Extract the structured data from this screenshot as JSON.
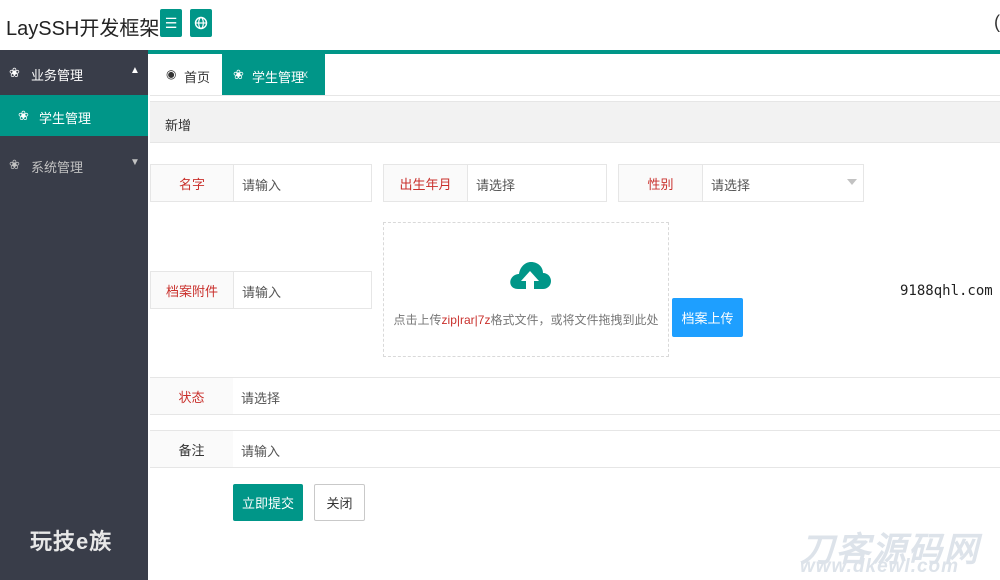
{
  "header": {
    "brand": "LaySSH开发框架",
    "menu_icon": "menu-icon",
    "globe_icon": "globe-icon",
    "right_text": "("
  },
  "sidebar": {
    "groups": [
      {
        "label": "业务管理",
        "icon": "cluster-icon",
        "expanded": true,
        "children": [
          {
            "label": "学生管理",
            "icon": "cluster-icon",
            "active": true
          }
        ]
      },
      {
        "label": "系统管理",
        "icon": "cluster-icon",
        "expanded": false
      }
    ],
    "watermark": "玩技e族"
  },
  "tabs": [
    {
      "label": "首页",
      "icon": "dashboard-icon",
      "active": false
    },
    {
      "label": "学生管理",
      "icon": "cluster-icon",
      "active": true,
      "close": "x"
    }
  ],
  "toolbar": {
    "add_label": "新增"
  },
  "form": {
    "name": {
      "label": "名字",
      "placeholder": "请输入"
    },
    "birth": {
      "label": "出生年月",
      "placeholder": "请选择"
    },
    "gender": {
      "label": "性别",
      "placeholder": "请选择"
    },
    "file": {
      "label": "档案附件",
      "placeholder": "请输入"
    },
    "dropzone": {
      "text_pre": "点击上传",
      "formats": "zip|rar|7z",
      "text_post": "格式文件，或将文件拖拽到此处"
    },
    "upload_button": "档案上传",
    "status": {
      "label": "状态",
      "placeholder": "请选择"
    },
    "remark": {
      "label": "备注",
      "placeholder": "请输入"
    },
    "submit_button": "立即提交",
    "close_button": "关闭"
  },
  "watermarks": {
    "url": "9188qhl.com",
    "brand": "刀客源码网",
    "brand_url": "www.dkewl.com"
  },
  "colors": {
    "accent": "#009688",
    "sidebar_bg": "#393D49",
    "upload_blue": "#1E9FFF",
    "label_red": "#c9302c"
  }
}
